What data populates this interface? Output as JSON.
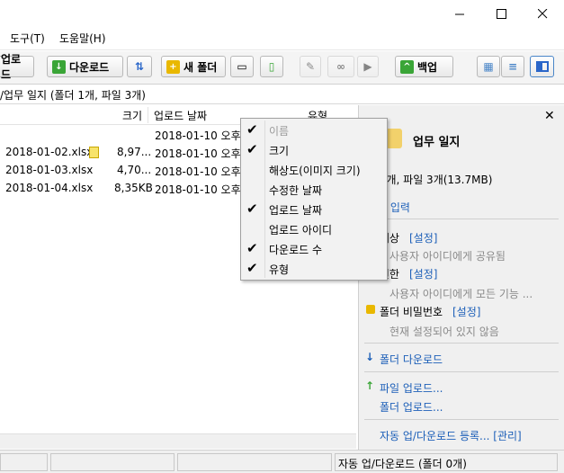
{
  "menu": {
    "tools": "도구(T)",
    "help": "도움말(H)"
  },
  "toolbar": {
    "upload": "업로드",
    "download": "다운로드",
    "new_folder": "새 폴더",
    "backup": "백업"
  },
  "path": "/업무 일지 (폴더 1개, 파일 3개)",
  "list": {
    "headers": {
      "size": "크기",
      "upload_date": "업로드 날짜",
      "type_partial": "유형"
    },
    "rows": [
      {
        "name": "",
        "size": "",
        "date": "2018-01-10 오후"
      },
      {
        "name": "2018-01-02.xlsx",
        "size": "8,97...",
        "date": "2018-01-10 오후"
      },
      {
        "name": "2018-01-03.xlsx",
        "size": "4,70...",
        "date": "2018-01-10 오후"
      },
      {
        "name": "2018-01-04.xlsx",
        "size": "8,35KB",
        "date": "2018-01-10 오후"
      }
    ]
  },
  "context_menu": {
    "items": [
      {
        "label": "이름",
        "checked": true,
        "disabled": true
      },
      {
        "label": "크기",
        "checked": true,
        "disabled": false
      },
      {
        "label": "해상도(이미지 크기)",
        "checked": false,
        "disabled": false
      },
      {
        "label": "수정한 날짜",
        "checked": false,
        "disabled": false
      },
      {
        "label": "업로드 날짜",
        "checked": true,
        "disabled": false
      },
      {
        "label": "업로드 아이디",
        "checked": false,
        "disabled": false
      },
      {
        "label": "다운로드 수",
        "checked": true,
        "disabled": false
      },
      {
        "label": "유형",
        "checked": true,
        "disabled": false
      }
    ]
  },
  "panel": {
    "folder_name": "업무 일지",
    "folder_info": "더 1개, 파일 3개(13.7MB)",
    "memo": "모 입력",
    "share_target_label": "유 대상",
    "share_target_value": "모든 사용자 아이디에게 공유됨",
    "permission_label": "용 권한",
    "permission_value": "사용자 아이디에게 모든 기능 ...",
    "set_link": "[설정]",
    "password_label": "폴더 비밀번호",
    "password_value": "현재 설정되어 있지 않음",
    "folder_download": "폴더 다운로드",
    "file_upload": "파일 업로드...",
    "folder_upload": "폴더 업로드...",
    "auto_sync": "자동 업/다운로드 등록... [관리]"
  },
  "status": {
    "text": "자동 업/다운로드 (폴더 0개)"
  },
  "colors": {
    "accent_blue": "#1c5fb8",
    "green": "#3aa537",
    "yellow": "#e9b800"
  }
}
